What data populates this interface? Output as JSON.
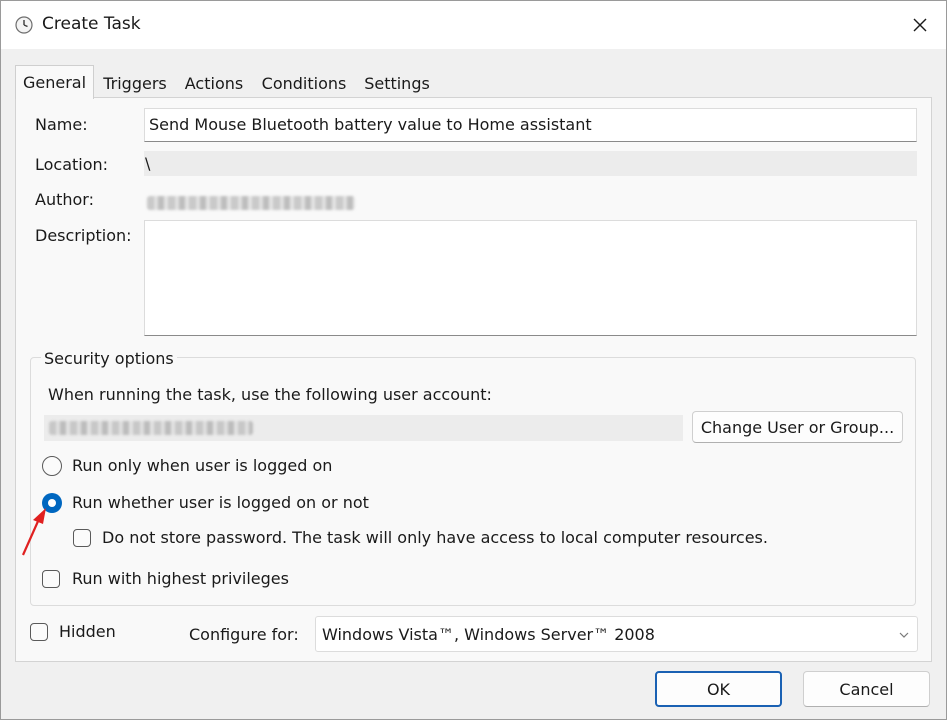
{
  "window": {
    "title": "Create Task",
    "icon": "clock-icon",
    "close_icon": "close-icon"
  },
  "tabs": [
    {
      "label": "General",
      "active": true
    },
    {
      "label": "Triggers",
      "active": false
    },
    {
      "label": "Actions",
      "active": false
    },
    {
      "label": "Conditions",
      "active": false
    },
    {
      "label": "Settings",
      "active": false
    }
  ],
  "general": {
    "name_label": "Name:",
    "name_value": "Send Mouse Bluetooth battery value to Home assistant",
    "location_label": "Location:",
    "location_value": "\\",
    "author_label": "Author:",
    "description_label": "Description:",
    "description_value": ""
  },
  "security": {
    "group_label": "Security options",
    "account_prompt": "When running the task, use the following user account:",
    "change_user_button": "Change User or Group...",
    "radio_logged_on": "Run only when user is logged on",
    "radio_whether": "Run whether user is logged on or not",
    "run_whether_selected": true,
    "do_not_store_label": "Do not store password.  The task will only have access to local computer resources.",
    "do_not_store_checked": false,
    "highest_privileges_label": "Run with highest privileges",
    "highest_privileges_checked": false
  },
  "bottom": {
    "hidden_label": "Hidden",
    "hidden_checked": false,
    "configure_label": "Configure for:",
    "configure_value": "Windows Vista™, Windows Server™ 2008",
    "ok_button": "OK",
    "cancel_button": "Cancel"
  },
  "colors": {
    "accent": "#0067c0",
    "primary_border": "#1a61b3",
    "annotation_arrow": "#e02020"
  }
}
